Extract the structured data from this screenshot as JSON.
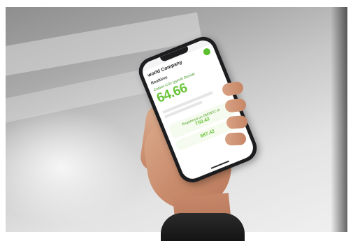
{
  "phone_screen": {
    "logo_text": "world Company",
    "section_title": "Realtime",
    "metric_label": "Carbon CO2 (ppm/t) Dioxide",
    "big_value": "64.66",
    "card1_title": "Registered on 09/08/22 at",
    "card1_value": "750.42",
    "card2_value": "687.42"
  }
}
